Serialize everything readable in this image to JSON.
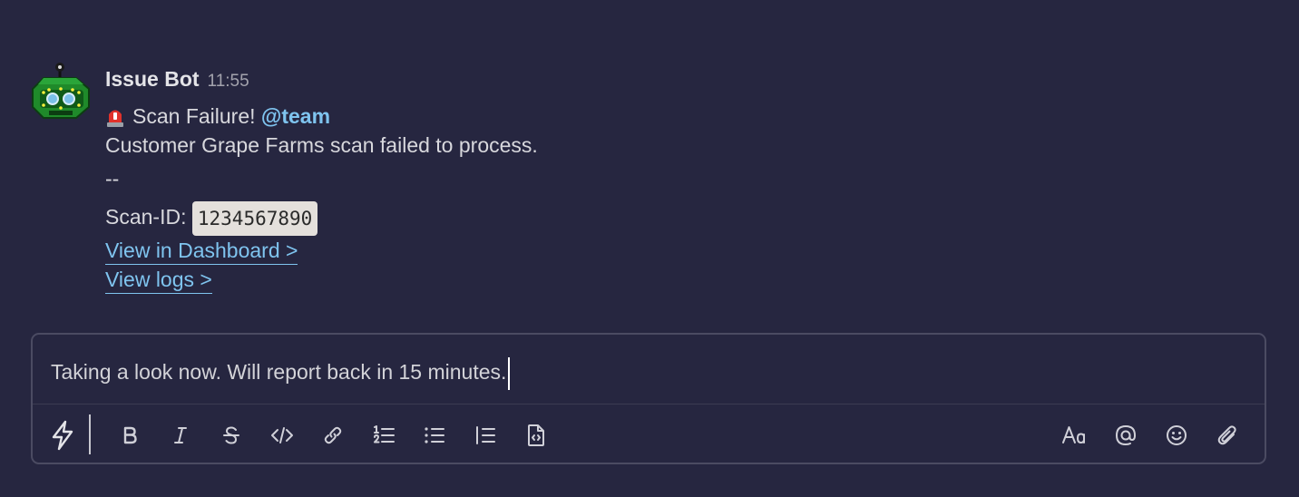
{
  "message": {
    "sender": "Issue Bot",
    "time": "11:55",
    "title": "Scan Failure!",
    "mention": "@team",
    "body": "Customer Grape Farms scan failed to process.",
    "separator": "--",
    "scan_id_label": "Scan-ID:",
    "scan_id_value": "1234567890",
    "links": [
      {
        "label": "View in Dashboard >"
      },
      {
        "label": "View logs >"
      }
    ]
  },
  "composer": {
    "text": "Taking a look now. Will report back in 15 minutes."
  },
  "toolbar": {
    "left": [
      "shortcuts-lightning-icon"
    ],
    "format": [
      "bold-icon",
      "italic-icon",
      "strikethrough-icon",
      "code-icon",
      "link-icon",
      "ordered-list-icon",
      "bulleted-list-icon",
      "blockquote-icon",
      "code-block-icon"
    ],
    "right": [
      "text-format-icon",
      "mention-icon",
      "emoji-icon",
      "attachment-icon"
    ]
  },
  "colors": {
    "background": "#262640",
    "link": "#7fc4ef",
    "mention": "#7fc4ef",
    "code_bg": "#e4e0dc",
    "composer_border": "#4b4b62"
  }
}
